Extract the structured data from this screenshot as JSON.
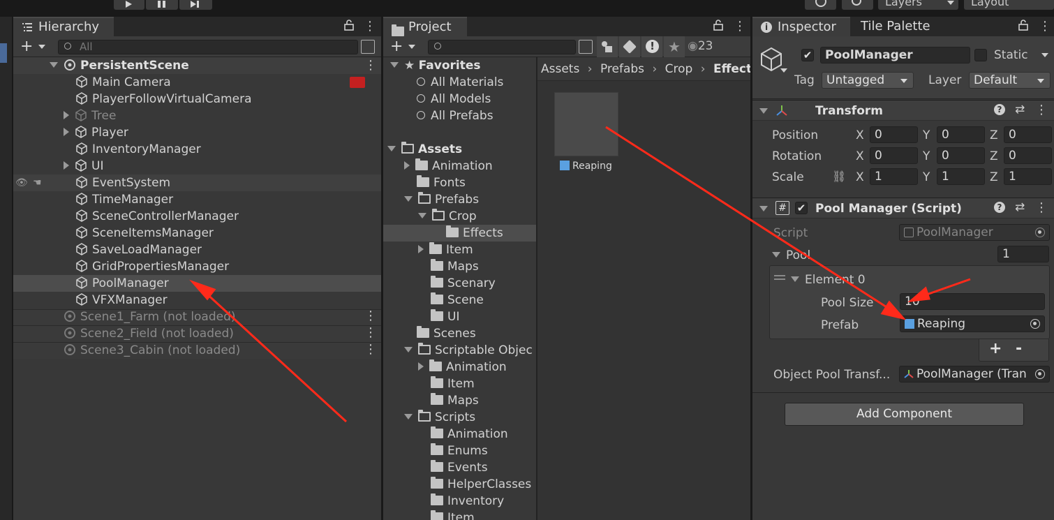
{
  "toolbar_top": {
    "layers_label": "Layers",
    "layout_label": "Layout"
  },
  "hierarchy": {
    "tab_label": "Hierarchy",
    "search_placeholder": "All",
    "scene_name": "PersistentScene",
    "items": [
      {
        "label": "Main Camera"
      },
      {
        "label": "PlayerFollowVirtualCamera"
      },
      {
        "label": "Tree"
      },
      {
        "label": "Player"
      },
      {
        "label": "InventoryManager"
      },
      {
        "label": "UI"
      },
      {
        "label": "EventSystem"
      },
      {
        "label": "TimeManager"
      },
      {
        "label": "SceneControllerManager"
      },
      {
        "label": "SceneItemsManager"
      },
      {
        "label": "SaveLoadManager"
      },
      {
        "label": "GridPropertiesManager"
      },
      {
        "label": "PoolManager"
      },
      {
        "label": "VFXManager"
      }
    ],
    "unloaded_scenes": [
      {
        "label": "Scene1_Farm (not loaded)"
      },
      {
        "label": "Scene2_Field (not loaded)"
      },
      {
        "label": "Scene3_Cabin (not loaded)"
      }
    ]
  },
  "project": {
    "tab_label": "Project",
    "visible_count": "23",
    "favorites_label": "Favorites",
    "favorites": [
      "All Materials",
      "All Models",
      "All Prefabs"
    ],
    "assets_label": "Assets",
    "tree": [
      "Animation",
      "Fonts",
      "Prefabs",
      "Crop",
      "Effects",
      "Item",
      "Maps",
      "Scenary",
      "Scene",
      "UI",
      "Scenes",
      "Scriptable Objec",
      "Animation",
      "Item",
      "Maps",
      "Scripts",
      "Animation",
      "Enums",
      "Events",
      "HelperClasses",
      "Inventory",
      "Item"
    ],
    "breadcrumb": [
      "Assets",
      "Prefabs",
      "Crop",
      "Effect"
    ],
    "asset_name": "Reaping"
  },
  "inspector": {
    "tab_label": "Inspector",
    "tab2_label": "Tile Palette",
    "object_name": "PoolManager",
    "static_label": "Static",
    "tag_label": "Tag",
    "tag_value": "Untagged",
    "layer_label": "Layer",
    "layer_value": "Default",
    "transform": {
      "title": "Transform",
      "position_label": "Position",
      "rotation_label": "Rotation",
      "scale_label": "Scale",
      "position": {
        "x": "0",
        "y": "0",
        "z": "0"
      },
      "rotation": {
        "x": "0",
        "y": "0",
        "z": "0"
      },
      "scale": {
        "x": "1",
        "y": "1",
        "z": "1"
      },
      "axis_x": "X",
      "axis_y": "Y",
      "axis_z": "Z"
    },
    "script_component": {
      "title": "Pool Manager (Script)",
      "script_label": "Script",
      "script_value": "PoolManager",
      "pool_label": "Pool",
      "pool_size_count": "1",
      "element_label": "Element 0",
      "pool_size_label": "Pool Size",
      "pool_size_value": "10",
      "prefab_label": "Prefab",
      "prefab_value": "Reaping",
      "plus": "+",
      "minus": "-",
      "object_pool_label": "Object Pool Transf...",
      "object_pool_value": "PoolManager (Tran"
    },
    "add_component_label": "Add Component"
  },
  "colors": {
    "annotation_arrow": "#ff2a1a",
    "selection": "#4d4d4d"
  }
}
